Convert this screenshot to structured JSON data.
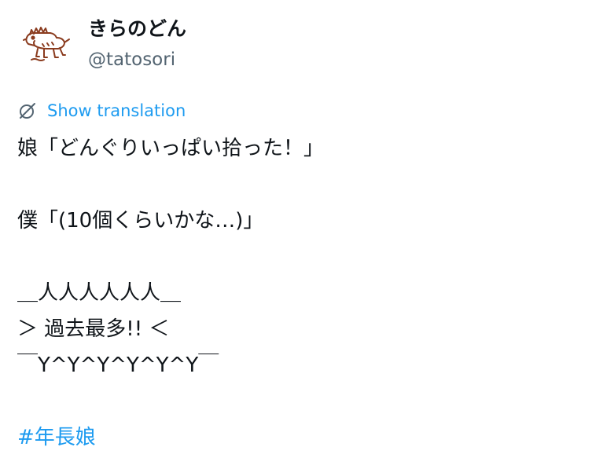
{
  "user": {
    "display_name": "きらのどん",
    "handle": "@tatosori"
  },
  "avatar_icon": "dog-sketch-avatar",
  "translation": {
    "label": "Show translation",
    "icon": "translate-globe-icon"
  },
  "tweet": {
    "lines": [
      "娘「どんぐりいっぱい拾った！」",
      "",
      "僕「(10個くらいかな…)」",
      "",
      "＿人人人人人人＿",
      "＞ 過去最多!! ＜",
      "￣Y^Y^Y^Y^Y^Y￣",
      ""
    ],
    "hashtag": "#年長娘"
  },
  "colors": {
    "link": "#1d9bf0",
    "text": "#0f1419",
    "secondary": "#536471"
  }
}
